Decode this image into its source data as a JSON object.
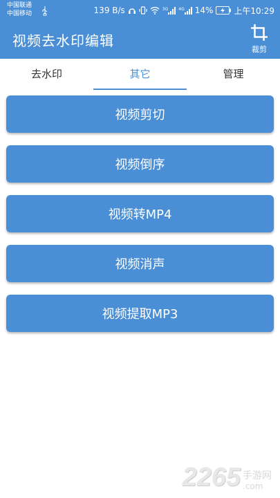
{
  "status_bar": {
    "carrier_1": "中国联通",
    "carrier_2": "中国移动",
    "net_speed": "139 B/s",
    "network_3g": "3G",
    "network_4g": "4G",
    "battery": "14%",
    "time": "上午10:29"
  },
  "app_bar": {
    "title": "视频去水印编辑",
    "crop_label": "裁剪"
  },
  "tabs": [
    {
      "label": "去水印",
      "active": false
    },
    {
      "label": "其它",
      "active": true
    },
    {
      "label": "管理",
      "active": false
    }
  ],
  "actions": [
    {
      "label": "视频剪切"
    },
    {
      "label": "视频倒序"
    },
    {
      "label": "视频转MP4"
    },
    {
      "label": "视频消声"
    },
    {
      "label": "视频提取MP3"
    }
  ],
  "watermark": {
    "number": "2265",
    "text_cn": "手游网",
    "text_en": ".com"
  },
  "colors": {
    "primary": "#4a8fd6",
    "background": "#ffffff",
    "tab_text": "#333333"
  }
}
